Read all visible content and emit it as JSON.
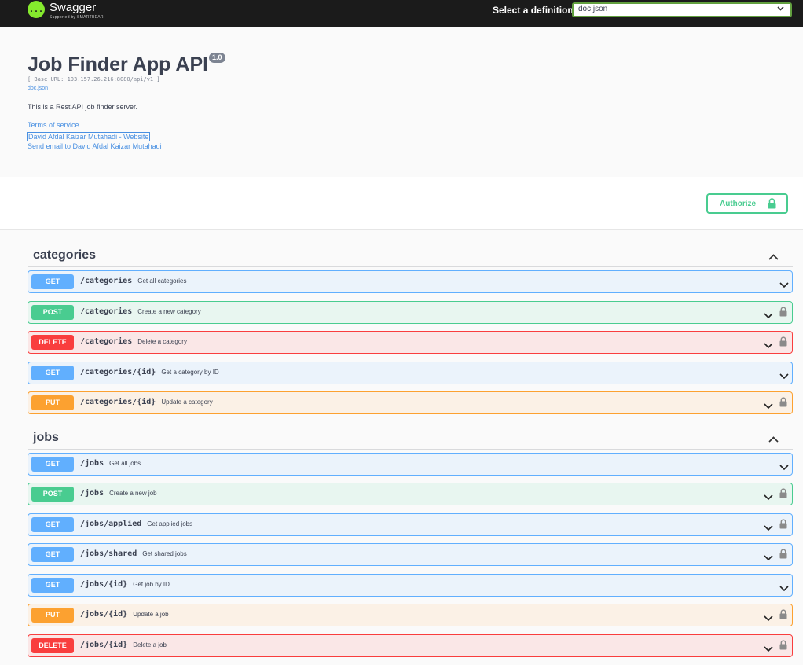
{
  "topbar": {
    "logo_glyph": "{...}",
    "logo_title": "Swagger",
    "logo_sub": "Supported by SMARTBEAR",
    "select_label": "Select a definition",
    "selected_definition": "doc.json"
  },
  "info": {
    "title": "Job Finder App API",
    "version": "1.0",
    "base_url": "[ Base URL: 103.157.26.216:8080/api/v1 ]",
    "doc_link": "doc.json",
    "description": "This is a Rest API job finder server.",
    "terms": "Terms of service",
    "website": "David Afdal Kaizar Mutahadi - Website",
    "email": "Send email to David Afdal Kaizar Mutahadi"
  },
  "authorize": {
    "label": "Authorize"
  },
  "colors": {
    "get": "#61affe",
    "post": "#49cc90",
    "delete": "#f93e3e",
    "put": "#fca130",
    "topbar": "#1b1b1b",
    "logo": "#85ea2d"
  },
  "icons": {
    "lock": "lock-icon",
    "chevron": "chevron-down-icon",
    "collapse": "chevron-up-icon"
  },
  "sections": [
    {
      "name": "categories",
      "operations": [
        {
          "method": "GET",
          "path": "/categories",
          "summary": "Get all categories",
          "locked": false
        },
        {
          "method": "POST",
          "path": "/categories",
          "summary": "Create a new category",
          "locked": true
        },
        {
          "method": "DELETE",
          "path": "/categories",
          "summary": "Delete a category",
          "locked": true
        },
        {
          "method": "GET",
          "path": "/categories/{id}",
          "summary": "Get a category by ID",
          "locked": false
        },
        {
          "method": "PUT",
          "path": "/categories/{id}",
          "summary": "Update a category",
          "locked": true
        }
      ]
    },
    {
      "name": "jobs",
      "operations": [
        {
          "method": "GET",
          "path": "/jobs",
          "summary": "Get all jobs",
          "locked": false
        },
        {
          "method": "POST",
          "path": "/jobs",
          "summary": "Create a new job",
          "locked": true
        },
        {
          "method": "GET",
          "path": "/jobs/applied",
          "summary": "Get applied jobs",
          "locked": true
        },
        {
          "method": "GET",
          "path": "/jobs/shared",
          "summary": "Get shared jobs",
          "locked": true
        },
        {
          "method": "GET",
          "path": "/jobs/{id}",
          "summary": "Get job by ID",
          "locked": false
        },
        {
          "method": "PUT",
          "path": "/jobs/{id}",
          "summary": "Update a job",
          "locked": true
        },
        {
          "method": "DELETE",
          "path": "/jobs/{id}",
          "summary": "Delete a job",
          "locked": true
        }
      ]
    }
  ]
}
